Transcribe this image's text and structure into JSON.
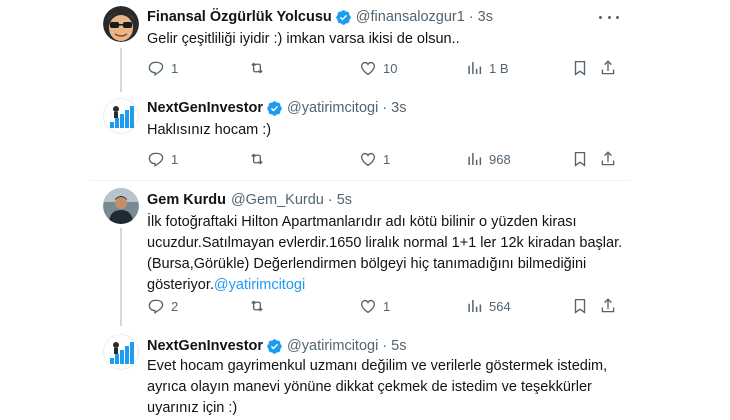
{
  "colors": {
    "accent": "#1d9bf0",
    "verified": "#1d9bf0",
    "text": "#0f1419",
    "muted": "#536471",
    "line": "#cfd9de"
  },
  "tweets": [
    {
      "name": "Finansal Özgürlük Yolcusu",
      "handle": "@finansalozgur1",
      "sep": "·",
      "time": "3s",
      "text": "Gelir çeşitliliği iyidir :) imkan varsa ikisi de olsun..",
      "replies": "1",
      "retweets": "",
      "likes": "10",
      "views": "1 B"
    },
    {
      "name": "NextGenInvestor",
      "handle": "@yatirimcitogi",
      "sep": "·",
      "time": "3s",
      "text": "Haklısınız hocam :)",
      "replies": "1",
      "retweets": "",
      "likes": "1",
      "views": "968"
    },
    {
      "name": "Gem Kurdu",
      "handle": "@Gem_Kurdu",
      "sep": "·",
      "time": "5s",
      "lines": [
        "İlk fotoğraftaki Hilton Apartmanlarıdır adı kötü bilinir o yüzden kirası",
        "ucuzdur.Satılmayan evlerdir.1650 liralık normal 1+1 ler 12k kiradan başlar.",
        "(Bursa,Görükle) Değerlendirmen bölgeyi hiç tanımadığını bilmediğini"
      ],
      "last_line_prefix": "gösteriyor.",
      "mention": "@yatirimcitogi",
      "replies": "2",
      "retweets": "",
      "likes": "1",
      "views": "564"
    },
    {
      "name": "NextGenInvestor",
      "handle": "@yatirimcitogi",
      "sep": "·",
      "time": "5s",
      "lines": [
        "Evet hocam gayrimenkul uzmanı değilim ve verilerle göstermek istedim,",
        "ayrıca olayın manevi yönüne dikkat çekmek de istedim ve teşekkürler",
        "uyarınız için :)"
      ]
    }
  ],
  "icons": {
    "reply": "reply-icon",
    "retweet": "retweet-icon",
    "like": "heart-icon",
    "views": "views-icon",
    "bookmark": "bookmark-icon",
    "share": "share-icon",
    "more": "more-icon",
    "verified": "verified-badge-icon"
  }
}
